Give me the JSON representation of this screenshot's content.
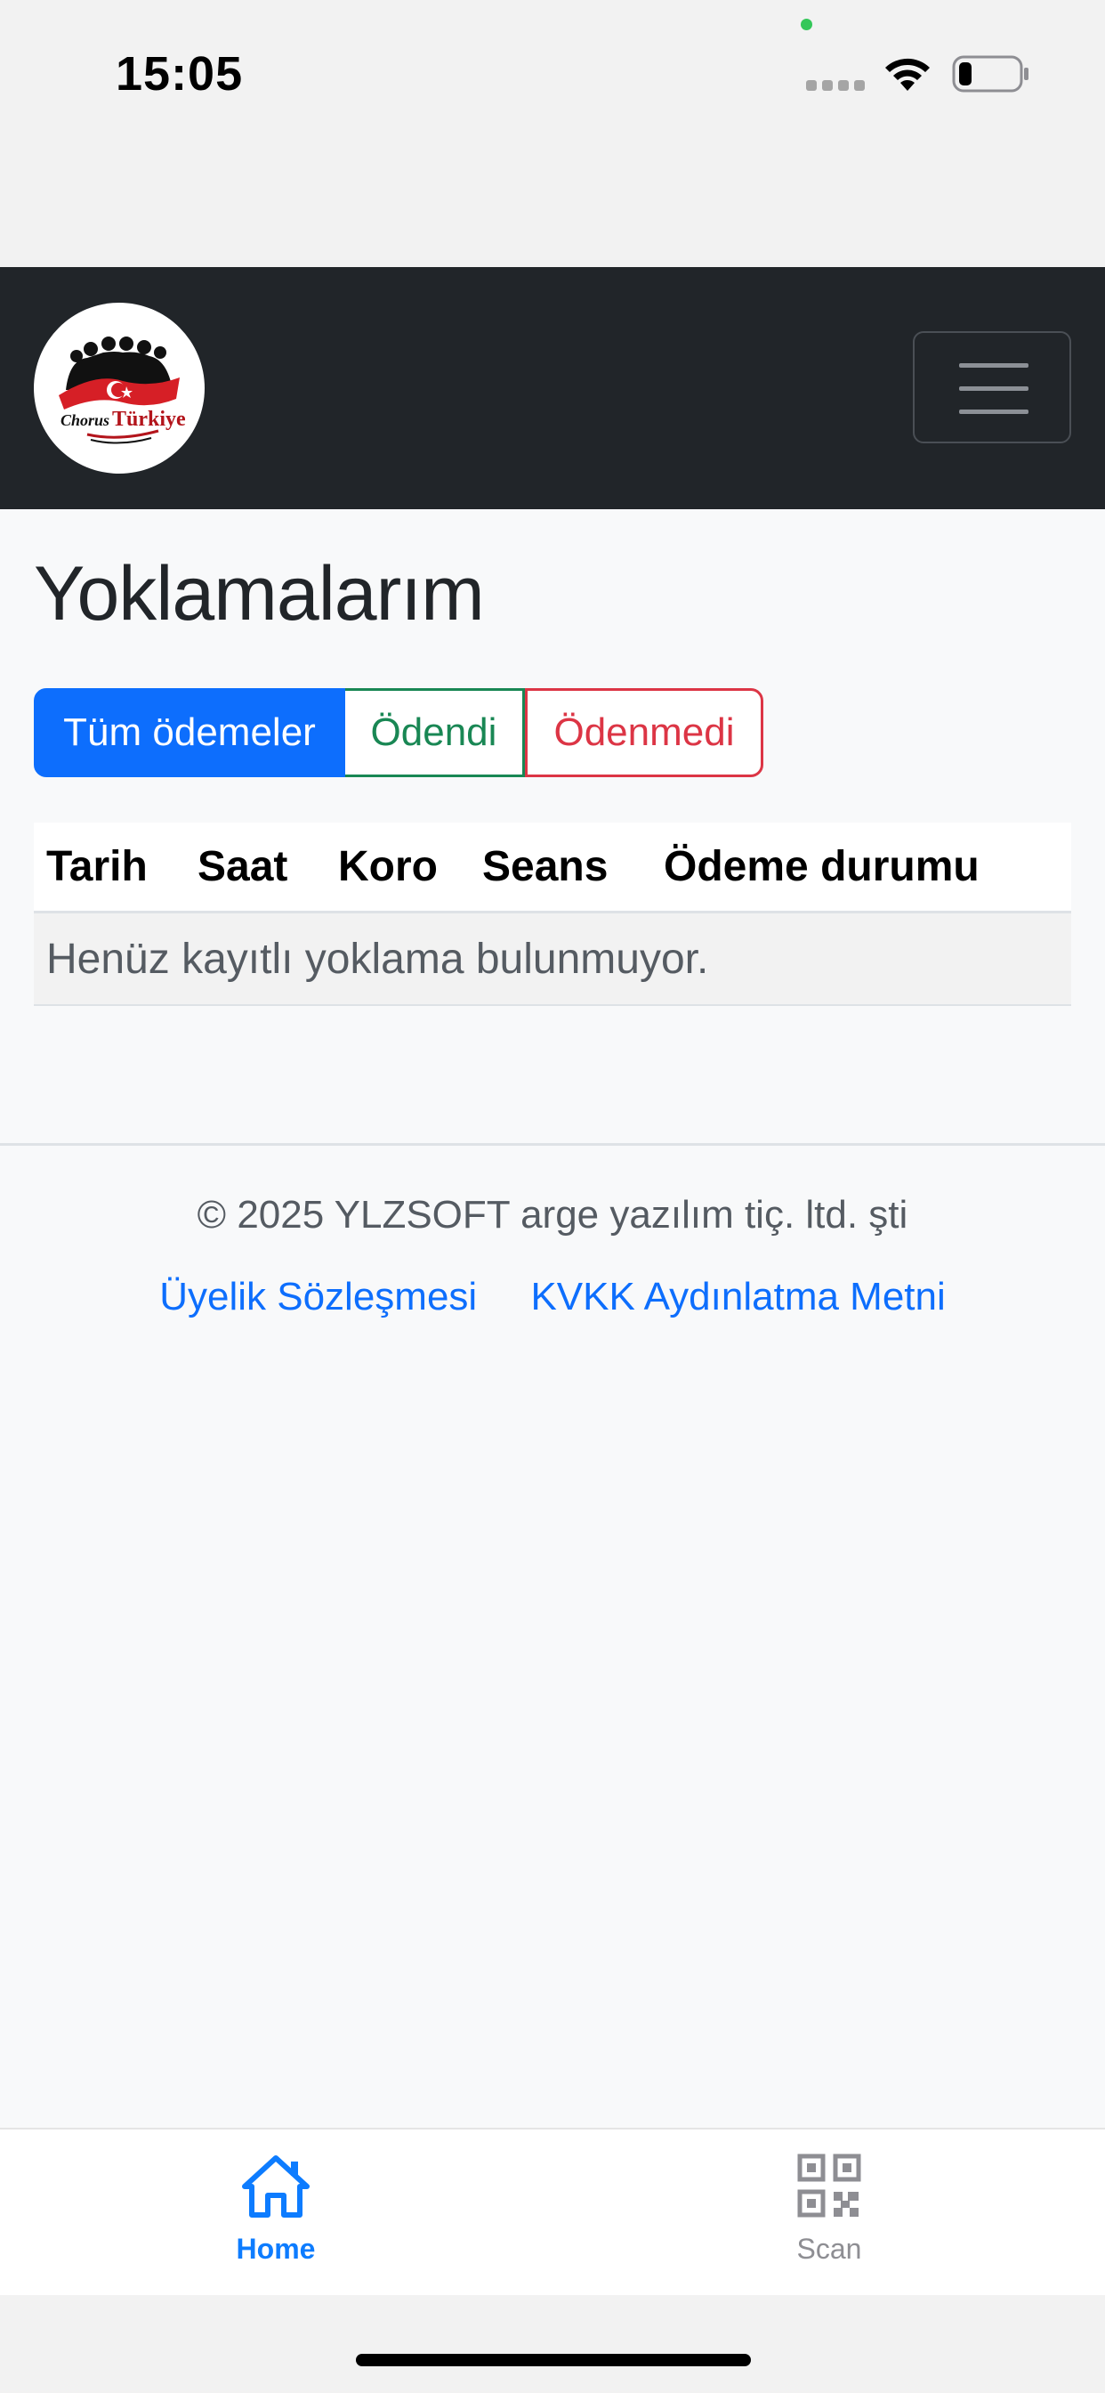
{
  "status_bar": {
    "time": "15:05"
  },
  "navbar": {
    "logo_text_1": "Chorus",
    "logo_text_2": "Türkiye"
  },
  "page": {
    "title": "Yoklamalarım"
  },
  "filters": {
    "all": "Tüm ödemeler",
    "paid": "Ödendi",
    "unpaid": "Ödenmedi"
  },
  "table": {
    "headers": [
      "Tarih",
      "Saat",
      "Koro",
      "Seans",
      "Ödeme durumu"
    ],
    "empty_message": "Henüz kayıtlı yoklama bulunmuyor."
  },
  "footer": {
    "copyright": "© 2025 YLZSOFT arge yazılım tiç. ltd. şti",
    "link_terms": "Üyelik Sözleşmesi",
    "link_kvkk": "KVKK Aydınlatma Metni"
  },
  "tab_bar": {
    "home": "Home",
    "scan": "Scan"
  },
  "colors": {
    "primary": "#0d6efd",
    "success": "#198754",
    "danger": "#dc3545",
    "navbar": "#212529"
  }
}
